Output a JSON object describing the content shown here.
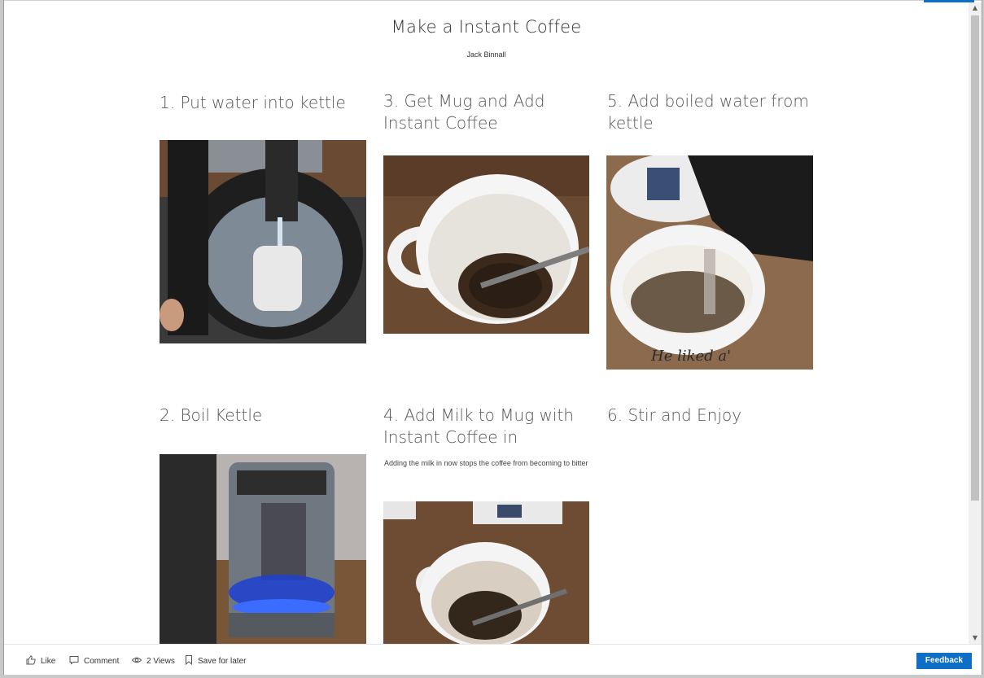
{
  "document": {
    "title": "Make a Instant Coffee",
    "author": "Jack Binnall"
  },
  "steps": [
    {
      "heading": "1. Put water into kettle",
      "note": "",
      "image": "kettle-filling-photo"
    },
    {
      "heading": "2. Boil Kettle",
      "note": "",
      "image": "kettle-boiling-photo"
    },
    {
      "heading": "3. Get Mug and Add Instant Coffee",
      "note": "",
      "image": "mug-with-coffee-photo"
    },
    {
      "heading": "4. Add Milk to Mug with Instant Coffee in",
      "note": "Adding the milk in now stops the coffee from becoming to bitter",
      "image": "mug-with-milk-photo"
    },
    {
      "heading": "5. Add boiled water from kettle",
      "note": "",
      "image": "pouring-water-photo"
    },
    {
      "heading": "6. Stir and Enjoy",
      "note": ""
    }
  ],
  "footer": {
    "like": "Like",
    "comment": "Comment",
    "views": "2 Views",
    "save": "Save for later",
    "feedback": "Feedback",
    "like_icon": "thumbs-up-icon",
    "comment_icon": "comment-icon",
    "views_icon": "eye-icon",
    "save_icon": "bookmark-icon"
  },
  "colors": {
    "accent": "#0f6fc6",
    "heading_text": "#555555",
    "background": "#ffffff"
  }
}
